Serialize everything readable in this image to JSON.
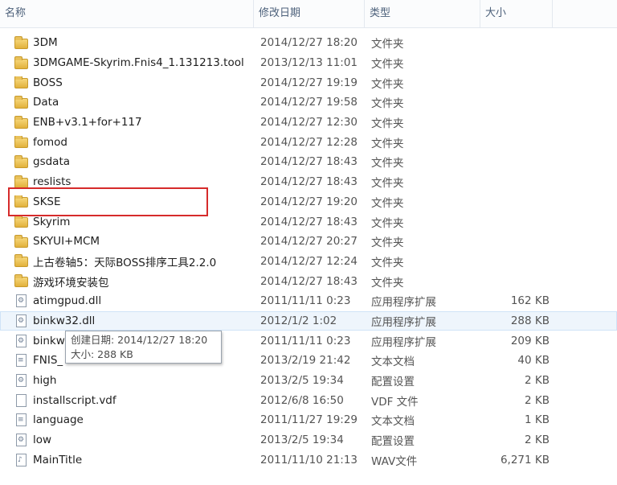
{
  "columns": {
    "name": "名称",
    "date": "修改日期",
    "type": "类型",
    "size": "大小"
  },
  "files": [
    {
      "name": "3DM",
      "date": "2014/12/27 18:20",
      "type": "文件夹",
      "size": "",
      "icon": "folder-icon"
    },
    {
      "name": "3DMGAME-Skyrim.Fnis4_1.131213.tool",
      "date": "2013/12/13 11:01",
      "type": "文件夹",
      "size": "",
      "icon": "folder-icon"
    },
    {
      "name": "BOSS",
      "date": "2014/12/27 19:19",
      "type": "文件夹",
      "size": "",
      "icon": "folder-icon"
    },
    {
      "name": "Data",
      "date": "2014/12/27 19:58",
      "type": "文件夹",
      "size": "",
      "icon": "folder-icon"
    },
    {
      "name": "ENB+v3.1+for+117",
      "date": "2014/12/27 12:30",
      "type": "文件夹",
      "size": "",
      "icon": "folder-icon"
    },
    {
      "name": "fomod",
      "date": "2014/12/27 12:28",
      "type": "文件夹",
      "size": "",
      "icon": "folder-icon"
    },
    {
      "name": "gsdata",
      "date": "2014/12/27 18:43",
      "type": "文件夹",
      "size": "",
      "icon": "folder-icon"
    },
    {
      "name": "reslists",
      "date": "2014/12/27 18:43",
      "type": "文件夹",
      "size": "",
      "icon": "folder-icon"
    },
    {
      "name": "SKSE",
      "date": "2014/12/27 19:20",
      "type": "文件夹",
      "size": "",
      "icon": "folder-icon"
    },
    {
      "name": "Skyrim",
      "date": "2014/12/27 18:43",
      "type": "文件夹",
      "size": "",
      "icon": "folder-icon"
    },
    {
      "name": "SKYUI+MCM",
      "date": "2014/12/27 20:27",
      "type": "文件夹",
      "size": "",
      "icon": "folder-icon"
    },
    {
      "name": "上古卷轴5：天际BOSS排序工具2.2.0",
      "date": "2014/12/27 12:24",
      "type": "文件夹",
      "size": "",
      "icon": "folder-icon"
    },
    {
      "name": "游戏环境安装包",
      "date": "2014/12/27 18:43",
      "type": "文件夹",
      "size": "",
      "icon": "folder-icon"
    },
    {
      "name": "atimgpud.dll",
      "date": "2011/11/11 0:23",
      "type": "应用程序扩展",
      "size": "162 KB",
      "icon": "dll-icon"
    },
    {
      "name": "binkw32.dll",
      "date": "2012/1/2 1:02",
      "type": "应用程序扩展",
      "size": "288 KB",
      "icon": "dll-icon"
    },
    {
      "name": "binkw",
      "date": "2011/11/11 0:23",
      "type": "应用程序扩展",
      "size": "209 KB",
      "icon": "dll-icon"
    },
    {
      "name": "FNIS_",
      "date": "2013/2/19 21:42",
      "type": "文本文档",
      "size": "40 KB",
      "icon": "text-file-icon"
    },
    {
      "name": "high",
      "date": "2013/2/5 19:34",
      "type": "配置设置",
      "size": "2 KB",
      "icon": "settings-file-icon"
    },
    {
      "name": "installscript.vdf",
      "date": "2012/6/8 16:50",
      "type": "VDF 文件",
      "size": "2 KB",
      "icon": "file-icon"
    },
    {
      "name": "language",
      "date": "2011/11/27 19:29",
      "type": "文本文档",
      "size": "1 KB",
      "icon": "text-file-icon"
    },
    {
      "name": "low",
      "date": "2013/2/5 19:34",
      "type": "配置设置",
      "size": "2 KB",
      "icon": "settings-file-icon"
    },
    {
      "name": "MainTitle",
      "date": "2011/11/10 21:13",
      "type": "WAV文件",
      "size": "6,271 KB",
      "icon": "audio-file-icon"
    }
  ],
  "tooltip": {
    "line1": "创建日期: 2014/12/27 18:20",
    "line2": "大小: 288 KB"
  }
}
